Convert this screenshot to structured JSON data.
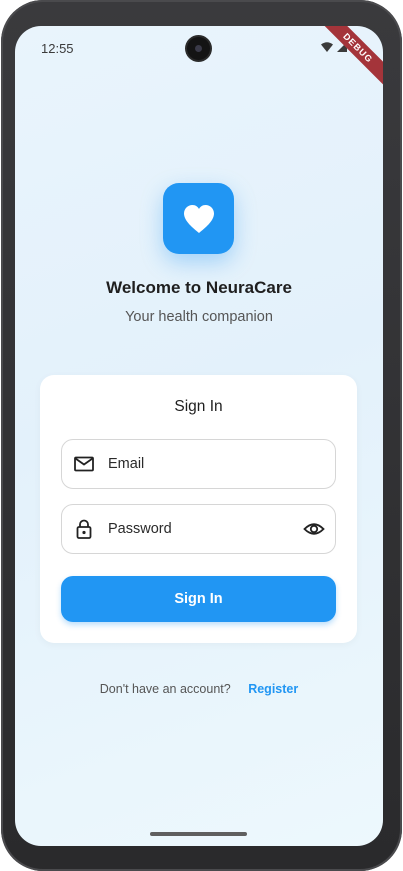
{
  "status_bar": {
    "time": "12:55",
    "debug_label": "DEBUG"
  },
  "app": {
    "title": "Welcome to NeuraCare",
    "subtitle": "Your health companion",
    "brand_color": "#2196F3",
    "logo_icon": "heart-icon"
  },
  "signin_card": {
    "title": "Sign In",
    "email": {
      "label": "Email",
      "icon": "mail-icon"
    },
    "password": {
      "label": "Password",
      "icon": "lock-icon",
      "toggle_icon": "eye-icon"
    },
    "button_label": "Sign In"
  },
  "register": {
    "prompt": "Don't have an account?",
    "link_label": "Register"
  }
}
